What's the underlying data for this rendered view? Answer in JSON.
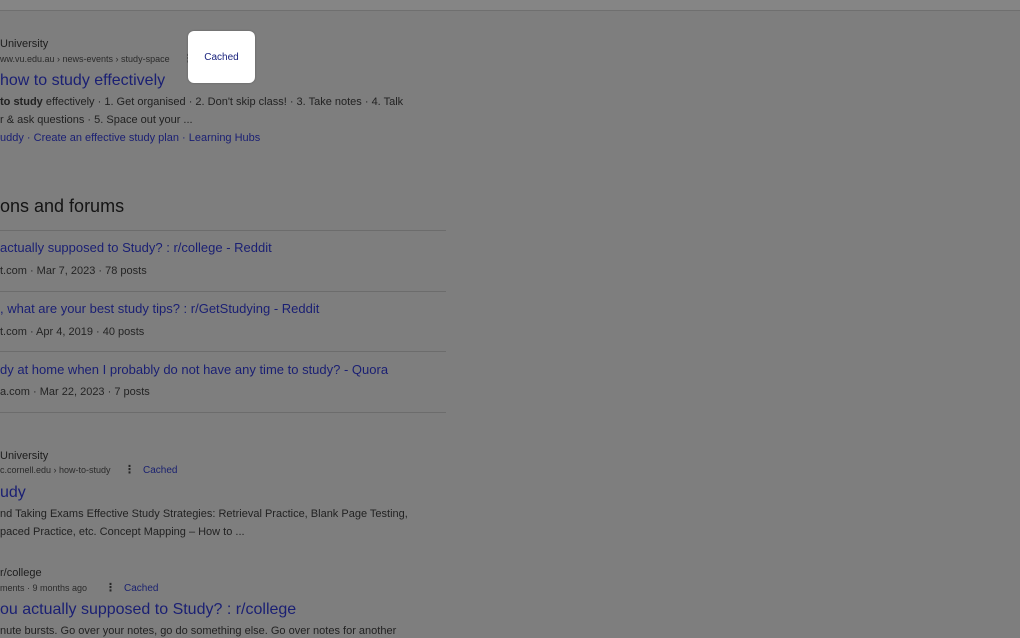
{
  "results": [
    {
      "site": "University",
      "breadcrumb": "ww.vu.edu.au › news-events › study-space",
      "title": "how to study effectively",
      "snippet_line1_bold": "to study",
      "snippet_line1_rest": " effectively · 1. Get organised · 2. Don't skip class! · 3. Take notes · 4. Talk",
      "snippet_line2": "r & ask questions · 5. Space out your ...",
      "sitelinks": "uddy · Create an effective study plan · Learning Hubs"
    },
    {
      "site": "University",
      "breadcrumb": "c.cornell.edu › how-to-study",
      "cached": "Cached",
      "title": "udy",
      "snippet_line1_rest": "nd Taking Exams Effective Study Strategies: Retrieval Practice, Blank Page Testing,",
      "snippet_line2": "paced Practice, etc. Concept Mapping – How to ..."
    },
    {
      "site": "r/college",
      "breadcrumb": "ments · 9 months ago",
      "cached": "Cached",
      "title": "ou actually supposed to Study? : r/college",
      "snippet_line1_rest": "nute bursts. Go over your notes, go do something else. Go over notes for another"
    }
  ],
  "discussions": {
    "heading": "ons and forums",
    "items": [
      {
        "title": "actually supposed to Study? : r/college - Reddit",
        "meta": "t.com · Mar 7, 2023 · 78 posts"
      },
      {
        "title": ", what are your best study tips? : r/GetStudying - Reddit",
        "meta": "t.com · Apr 4, 2019 · 40 posts"
      },
      {
        "title": "dy at home when I probably do not have any time to study? - Quora",
        "meta": "a.com · Mar 22, 2023 · 7 posts"
      }
    ]
  },
  "popup": {
    "label": "Cached"
  },
  "icons": {
    "more": "more-vert-icon"
  }
}
